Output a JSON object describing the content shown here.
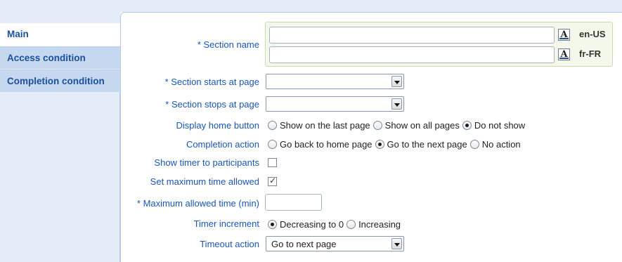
{
  "sidebar": {
    "tabs": [
      {
        "label": "Main",
        "active": true
      },
      {
        "label": "Access condition",
        "active": false
      },
      {
        "label": "Completion condition",
        "active": false
      }
    ]
  },
  "form": {
    "section_name": {
      "label": "* Section name",
      "languages": [
        {
          "code": "en-US",
          "value": "",
          "icon": "A"
        },
        {
          "code": "fr-FR",
          "value": "",
          "icon": "A"
        }
      ]
    },
    "starts_at": {
      "label": "* Section starts at page",
      "value": ""
    },
    "stops_at": {
      "label": "* Section stops at page",
      "value": ""
    },
    "display_home": {
      "label": "Display home button",
      "options": [
        "Show on the last page",
        "Show on all pages",
        "Do not show"
      ],
      "selected": "Do not show"
    },
    "completion_action": {
      "label": "Completion action",
      "options": [
        "Go back to home page",
        "Go to the next page",
        "No action"
      ],
      "selected": "Go to the next page"
    },
    "show_timer": {
      "label": "Show timer to participants",
      "checked": false
    },
    "set_max_time": {
      "label": "Set maximum time allowed",
      "checked": true
    },
    "max_time": {
      "label": "* Maximum allowed time (min)",
      "value": ""
    },
    "timer_increment": {
      "label": "Timer increment",
      "options": [
        "Decreasing to 0",
        "Increasing"
      ],
      "selected": "Decreasing to 0"
    },
    "timeout_action": {
      "label": "Timeout action",
      "value": "Go to next page"
    }
  }
}
